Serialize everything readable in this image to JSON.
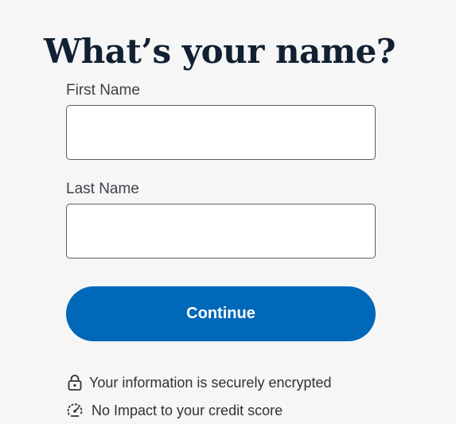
{
  "page": {
    "title": "What’s your name?"
  },
  "form": {
    "first_name": {
      "label": "First Name",
      "value": "",
      "placeholder": ""
    },
    "last_name": {
      "label": "Last Name",
      "value": "",
      "placeholder": ""
    },
    "continue_label": "Continue"
  },
  "notes": [
    {
      "icon": "lock-icon",
      "text": "Your information is securely encrypted"
    },
    {
      "icon": "speedometer-icon",
      "text": "No Impact to your credit score"
    }
  ],
  "colors": {
    "accent": "#0068b9",
    "title": "#122033",
    "background": "#f5f6f5"
  }
}
